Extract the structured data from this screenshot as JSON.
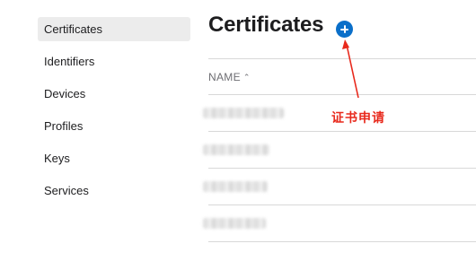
{
  "sidebar": {
    "items": [
      {
        "label": "Certificates",
        "active": true
      },
      {
        "label": "Identifiers"
      },
      {
        "label": "Devices"
      },
      {
        "label": "Profiles"
      },
      {
        "label": "Keys"
      },
      {
        "label": "Services"
      }
    ]
  },
  "header": {
    "title": "Certificates",
    "add_icon": "plus-circle-icon"
  },
  "table": {
    "columns": [
      {
        "label": "NAME",
        "sort": "ascending",
        "sort_icon": "chevron-up-icon"
      }
    ],
    "rows": [
      {
        "name": ""
      },
      {
        "name": ""
      },
      {
        "name": ""
      },
      {
        "name": ""
      }
    ]
  },
  "annotation": {
    "text": "证书申请",
    "color": "#e8291c"
  },
  "colors": {
    "accent": "#0a6fc9",
    "sidebar_active_bg": "#ececec",
    "annotation": "#e8291c"
  }
}
